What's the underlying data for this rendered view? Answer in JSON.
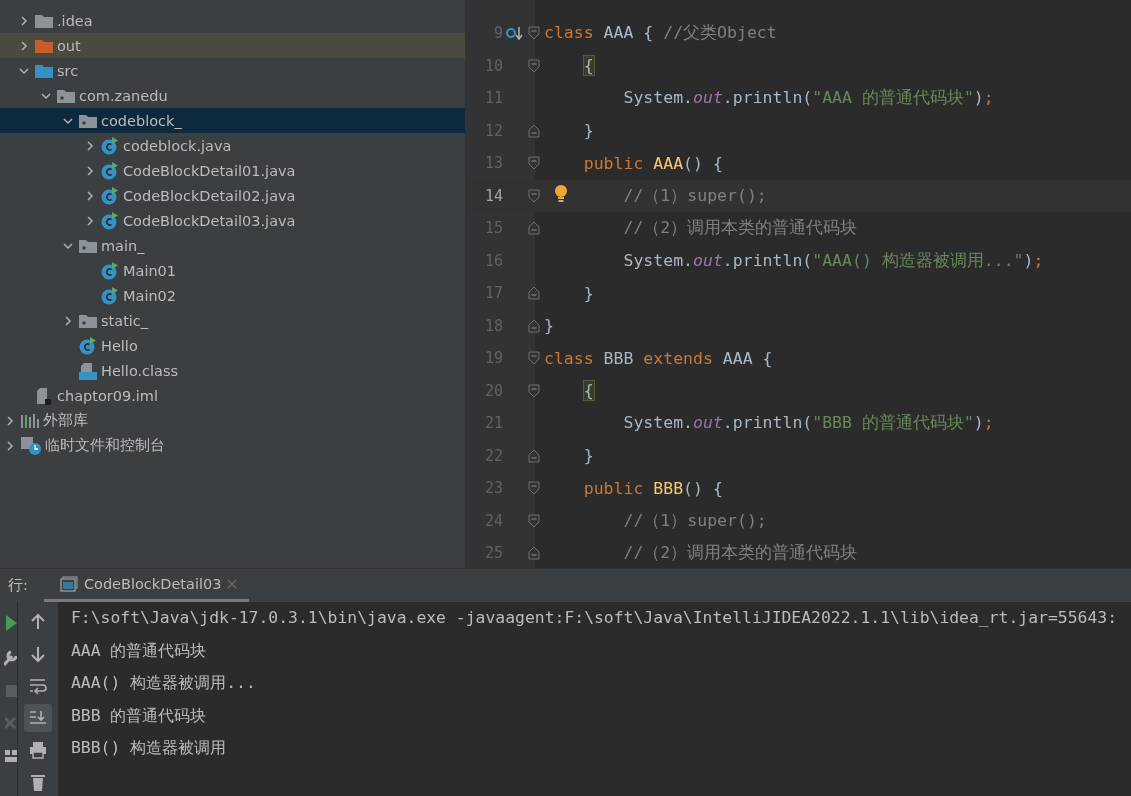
{
  "project_tree": {
    "children": [
      {
        "label": ".idea",
        "kind": "folder",
        "expanded": false,
        "selected": false
      },
      {
        "label": "out",
        "kind": "excluded-folder",
        "expanded": false,
        "selected": false
      },
      {
        "label": "src",
        "kind": "source-folder",
        "expanded": true,
        "selected": false,
        "children": [
          {
            "label": "com.zanedu",
            "kind": "package",
            "expanded": true,
            "selected": false,
            "children": [
              {
                "label": "codeblock_",
                "kind": "package",
                "expanded": true,
                "selected": true,
                "children": [
                  {
                    "label": "codeblock.java",
                    "kind": "class",
                    "expanded": false,
                    "selected": false
                  },
                  {
                    "label": "CodeBlockDetail01.java",
                    "kind": "class",
                    "expanded": false,
                    "selected": false
                  },
                  {
                    "label": "CodeBlockDetail02.java",
                    "kind": "class",
                    "expanded": false,
                    "selected": false
                  },
                  {
                    "label": "CodeBlockDetail03.java",
                    "kind": "class",
                    "expanded": false,
                    "selected": false
                  }
                ]
              },
              {
                "label": "main_",
                "kind": "package",
                "expanded": true,
                "selected": false,
                "children": [
                  {
                    "label": "Main01",
                    "kind": "class",
                    "selected": false
                  },
                  {
                    "label": "Main02",
                    "kind": "class",
                    "selected": false
                  }
                ]
              },
              {
                "label": "static_",
                "kind": "package",
                "expanded": false,
                "selected": false
              },
              {
                "label": "Hello",
                "kind": "class",
                "selected": false
              },
              {
                "label": "Hello.class",
                "kind": "classfile",
                "selected": false
              }
            ]
          }
        ]
      },
      {
        "label": "chaptor09.iml",
        "kind": "iml",
        "selected": false
      }
    ],
    "roots": [
      {
        "label": "外部库",
        "kind": "library",
        "expanded": false,
        "selected": false
      },
      {
        "label": "临时文件和控制台",
        "kind": "scratches",
        "expanded": false,
        "selected": false
      }
    ]
  },
  "editor": {
    "lines": [
      {
        "number": "9",
        "current": false,
        "marker": {
          "kind": "implemented"
        },
        "fold": {
          "kind": "start"
        },
        "tokens": [
          {
            "kind": "keyword",
            "text": "class"
          },
          {
            "kind": "plain",
            "text": " AAA { "
          },
          {
            "kind": "comment",
            "text": "//父类Object"
          }
        ]
      },
      {
        "number": "10",
        "current": false,
        "fold": {
          "kind": "start"
        },
        "tokens": [
          {
            "kind": "brace-match",
            "text": "    {"
          }
        ]
      },
      {
        "number": "11",
        "current": false,
        "tokens": [
          {
            "kind": "plain",
            "text": "        System."
          },
          {
            "kind": "field",
            "text": "out"
          },
          {
            "kind": "plain",
            "text": ".println("
          },
          {
            "kind": "string",
            "text": "\"AAA 的普通代码块\""
          },
          {
            "kind": "plain",
            "text": ")"
          },
          {
            "kind": "semicolon",
            "text": ";"
          }
        ]
      },
      {
        "number": "12",
        "current": false,
        "fold": {
          "kind": "end"
        },
        "tokens": [
          {
            "kind": "plain",
            "text": "    }"
          }
        ]
      },
      {
        "number": "13",
        "current": false,
        "fold": {
          "kind": "start"
        },
        "tokens": [
          {
            "kind": "keyword",
            "text": "    public "
          },
          {
            "kind": "decl",
            "text": "AAA"
          },
          {
            "kind": "plain",
            "text": "() {"
          }
        ]
      },
      {
        "number": "14",
        "current": true,
        "marker": {
          "kind": "bulb"
        },
        "fold": {
          "kind": "start"
        },
        "tokens": [
          {
            "kind": "comment",
            "text": "        //（1）super();"
          }
        ]
      },
      {
        "number": "15",
        "current": false,
        "fold": {
          "kind": "end"
        },
        "tokens": [
          {
            "kind": "comment",
            "text": "        //（2）调用本类的普通代码块"
          }
        ]
      },
      {
        "number": "16",
        "current": false,
        "tokens": [
          {
            "kind": "plain",
            "text": "        System."
          },
          {
            "kind": "field",
            "text": "out"
          },
          {
            "kind": "plain",
            "text": ".println("
          },
          {
            "kind": "string",
            "text": "\"AAA() 构造器被调用...\""
          },
          {
            "kind": "plain",
            "text": ")"
          },
          {
            "kind": "semicolon",
            "text": ";"
          }
        ]
      },
      {
        "number": "17",
        "current": false,
        "fold": {
          "kind": "end"
        },
        "tokens": [
          {
            "kind": "plain",
            "text": "    }"
          }
        ]
      },
      {
        "number": "18",
        "current": false,
        "fold": {
          "kind": "end"
        },
        "tokens": [
          {
            "kind": "plain",
            "text": "}"
          }
        ]
      },
      {
        "number": "19",
        "current": false,
        "fold": {
          "kind": "start"
        },
        "tokens": [
          {
            "kind": "keyword",
            "text": "class"
          },
          {
            "kind": "plain",
            "text": " BBB "
          },
          {
            "kind": "keyword",
            "text": "extends"
          },
          {
            "kind": "plain",
            "text": " AAA {"
          }
        ]
      },
      {
        "number": "20",
        "current": false,
        "fold": {
          "kind": "start"
        },
        "tokens": [
          {
            "kind": "brace-match",
            "text": "    {"
          }
        ]
      },
      {
        "number": "21",
        "current": false,
        "tokens": [
          {
            "kind": "plain",
            "text": "        System."
          },
          {
            "kind": "field",
            "text": "out"
          },
          {
            "kind": "plain",
            "text": ".println("
          },
          {
            "kind": "string",
            "text": "\"BBB 的普通代码块\""
          },
          {
            "kind": "plain",
            "text": ")"
          },
          {
            "kind": "semicolon",
            "text": ";"
          }
        ]
      },
      {
        "number": "22",
        "current": false,
        "fold": {
          "kind": "end"
        },
        "tokens": [
          {
            "kind": "plain",
            "text": "    }"
          }
        ]
      },
      {
        "number": "23",
        "current": false,
        "fold": {
          "kind": "start"
        },
        "tokens": [
          {
            "kind": "keyword",
            "text": "    public "
          },
          {
            "kind": "decl",
            "text": "BBB"
          },
          {
            "kind": "plain",
            "text": "() {"
          }
        ]
      },
      {
        "number": "24",
        "current": false,
        "fold": {
          "kind": "start"
        },
        "tokens": [
          {
            "kind": "comment",
            "text": "        //（1）super();"
          }
        ]
      },
      {
        "number": "25",
        "current": false,
        "fold": {
          "kind": "end"
        },
        "tokens": [
          {
            "kind": "comment",
            "text": "        //（2）调用本类的普通代码块"
          }
        ]
      }
    ]
  },
  "run_panel": {
    "label": "行:",
    "tabs": [
      {
        "label": "CodeBlockDetail03",
        "selected": true
      }
    ],
    "left_tools": [
      {
        "kind": "run"
      },
      {
        "kind": "wrench"
      },
      {
        "kind": "stop"
      },
      {
        "kind": "restore"
      },
      {
        "kind": "layout"
      }
    ],
    "tools": [
      {
        "kind": "up",
        "selected": false
      },
      {
        "kind": "down",
        "selected": false
      },
      {
        "kind": "wrap",
        "selected": false
      },
      {
        "kind": "scroll-end",
        "selected": true
      },
      {
        "kind": "print",
        "selected": false
      },
      {
        "kind": "trash",
        "selected": false
      }
    ],
    "console": [
      "F:\\soft\\Java\\jdk-17.0.3.1\\bin\\java.exe -javaagent:F:\\soft\\Java\\IntelliJIDEA2022.1.1\\lib\\idea_rt.jar=55643:",
      "AAA 的普通代码块",
      "AAA() 构造器被调用...",
      "BBB 的普通代码块",
      "BBB() 构造器被调用"
    ]
  }
}
